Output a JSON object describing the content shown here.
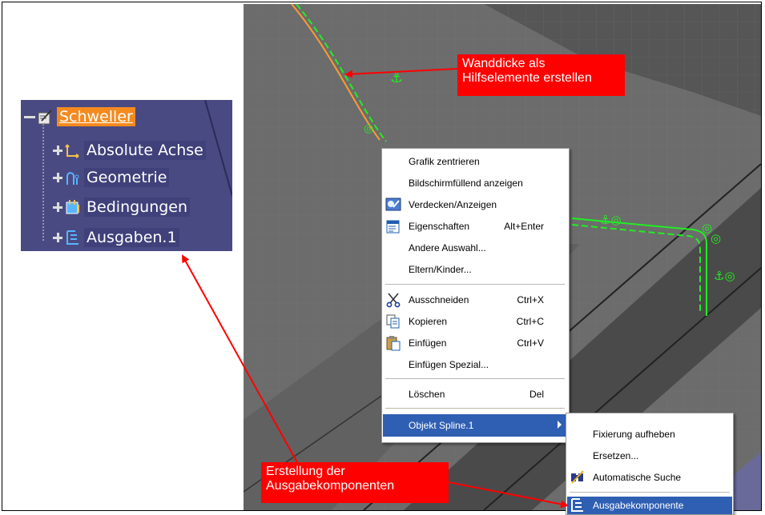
{
  "tree": {
    "root_label": "Schweller",
    "items": [
      {
        "label": "Absolute Achse",
        "icon": "axis-system-icon"
      },
      {
        "label": "Geometrie",
        "icon": "geometry-icon"
      },
      {
        "label": "Bedingungen",
        "icon": "constraints-icon"
      },
      {
        "label": "Ausgaben.1",
        "icon": "outputs-icon"
      }
    ]
  },
  "context_menu": {
    "items": [
      {
        "label": "Grafik zentrieren",
        "accel": ""
      },
      {
        "label": "Bildschirmfüllend anzeigen",
        "accel": ""
      },
      {
        "label": "Verdecken/Anzeigen",
        "accel": ""
      },
      {
        "label": "Eigenschaften",
        "accel": "Alt+Enter"
      },
      {
        "label": "Andere Auswahl...",
        "accel": ""
      },
      {
        "label": "Eltern/Kinder...",
        "accel": ""
      },
      {
        "label": "Ausschneiden",
        "accel": "Ctrl+X"
      },
      {
        "label": "Kopieren",
        "accel": "Ctrl+C"
      },
      {
        "label": "Einfügen",
        "accel": "Ctrl+V"
      },
      {
        "label": "Einfügen Spezial...",
        "accel": ""
      },
      {
        "label": "Löschen",
        "accel": "Del"
      },
      {
        "label": "Objekt Spline.1",
        "accel": ""
      }
    ]
  },
  "submenu": {
    "items": [
      {
        "label": "Fixierung aufheben"
      },
      {
        "label": "Ersetzen..."
      },
      {
        "label": "Automatische Suche"
      },
      {
        "label": "Ausgabekomponente"
      }
    ]
  },
  "callouts": {
    "top_line1": "Wanddicke als",
    "top_line2": "Hilfselemente erstellen",
    "bottom_line1": "Erstellung der",
    "bottom_line2": "Ausgabekomponenten"
  },
  "colors": {
    "callout": "#ff0000",
    "highlight": "#2f5fb3",
    "tree_bg": "#4a4a82",
    "root_label_bg": "#f58a1f",
    "spline_green": "#22ee22"
  }
}
